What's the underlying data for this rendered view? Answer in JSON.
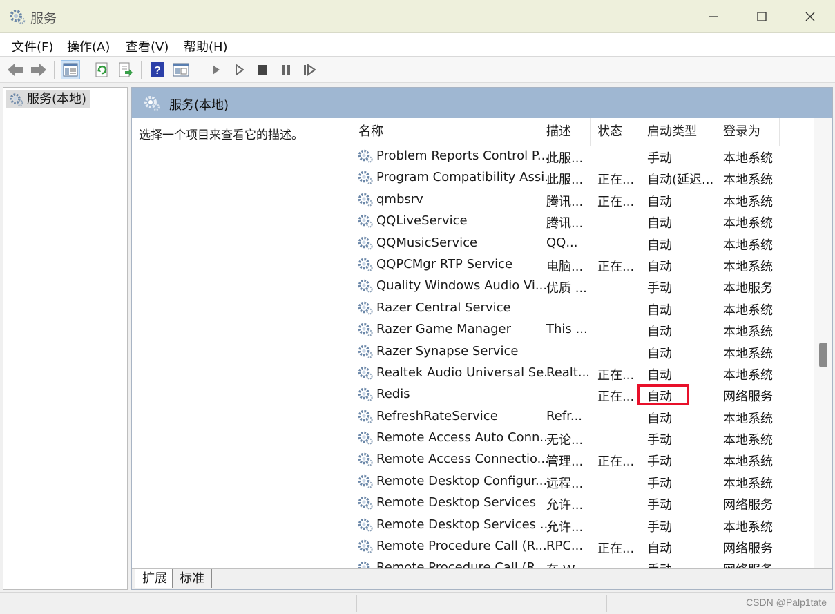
{
  "window": {
    "title": "服务"
  },
  "menu": [
    "文件(F)",
    "操作(A)",
    "查看(V)",
    "帮助(H)"
  ],
  "toolbar": [
    "back-icon",
    "forward-icon",
    "show-tree-icon",
    "refresh-icon",
    "export-icon",
    "help-icon",
    "properties-icon",
    "start-icon",
    "start-alt-icon",
    "stop-icon",
    "pause-icon",
    "resume-icon"
  ],
  "tree": {
    "root": "服务(本地)"
  },
  "content": {
    "header": "服务(本地)",
    "description_prompt": "选择一个项目来查看它的描述。",
    "columns": [
      "名称",
      "描述",
      "状态",
      "启动类型",
      "登录为"
    ],
    "rows": [
      {
        "name": "Problem Reports Control P...",
        "desc": "此服...",
        "status": "",
        "startup": "手动",
        "logon": "本地系统"
      },
      {
        "name": "Program Compatibility Assi...",
        "desc": "此服...",
        "status": "正在...",
        "startup": "自动(延迟...",
        "logon": "本地系统"
      },
      {
        "name": "qmbsrv",
        "desc": "腾讯...",
        "status": "正在...",
        "startup": "自动",
        "logon": "本地系统"
      },
      {
        "name": "QQLiveService",
        "desc": "腾讯...",
        "status": "",
        "startup": "自动",
        "logon": "本地系统"
      },
      {
        "name": "QQMusicService",
        "desc": "QQ...",
        "status": "",
        "startup": "自动",
        "logon": "本地系统"
      },
      {
        "name": "QQPCMgr RTP Service",
        "desc": "电脑...",
        "status": "正在...",
        "startup": "自动",
        "logon": "本地系统"
      },
      {
        "name": "Quality Windows Audio Vi...",
        "desc": "优质 ...",
        "status": "",
        "startup": "手动",
        "logon": "本地服务"
      },
      {
        "name": "Razer Central Service",
        "desc": "",
        "status": "",
        "startup": "自动",
        "logon": "本地系统"
      },
      {
        "name": "Razer Game Manager",
        "desc": "This ...",
        "status": "",
        "startup": "自动",
        "logon": "本地系统"
      },
      {
        "name": "Razer Synapse Service",
        "desc": "",
        "status": "",
        "startup": "自动",
        "logon": "本地系统"
      },
      {
        "name": "Realtek Audio Universal Se...",
        "desc": "Realt...",
        "status": "正在...",
        "startup": "自动",
        "logon": "本地系统"
      },
      {
        "name": "Redis",
        "desc": "",
        "status": "正在...",
        "startup": "自动",
        "logon": "网络服务"
      },
      {
        "name": "RefreshRateService",
        "desc": "Refr...",
        "status": "",
        "startup": "自动",
        "logon": "本地系统"
      },
      {
        "name": "Remote Access Auto Conn...",
        "desc": "无论...",
        "status": "",
        "startup": "手动",
        "logon": "本地系统"
      },
      {
        "name": "Remote Access Connectio...",
        "desc": "管理...",
        "status": "正在...",
        "startup": "手动",
        "logon": "本地系统"
      },
      {
        "name": "Remote Desktop Configur...",
        "desc": "远程...",
        "status": "",
        "startup": "手动",
        "logon": "本地系统"
      },
      {
        "name": "Remote Desktop Services",
        "desc": "允许...",
        "status": "",
        "startup": "手动",
        "logon": "网络服务"
      },
      {
        "name": "Remote Desktop Services ...",
        "desc": "允许...",
        "status": "",
        "startup": "手动",
        "logon": "本地系统"
      },
      {
        "name": "Remote Procedure Call (R...",
        "desc": "RPC...",
        "status": "正在...",
        "startup": "自动",
        "logon": "网络服务"
      },
      {
        "name": "Remote Procedure Call (R...",
        "desc": "在 W...",
        "status": "",
        "startup": "手动",
        "logon": "网络服务"
      }
    ],
    "highlight_row": 11
  },
  "tabs": [
    "扩展",
    "标准"
  ],
  "watermark": "CSDN @Palp1tate",
  "colors": {
    "header_bg": "#9fb7d2",
    "highlight": "#e8102a",
    "titlebar_bg": "#eef0dc"
  }
}
